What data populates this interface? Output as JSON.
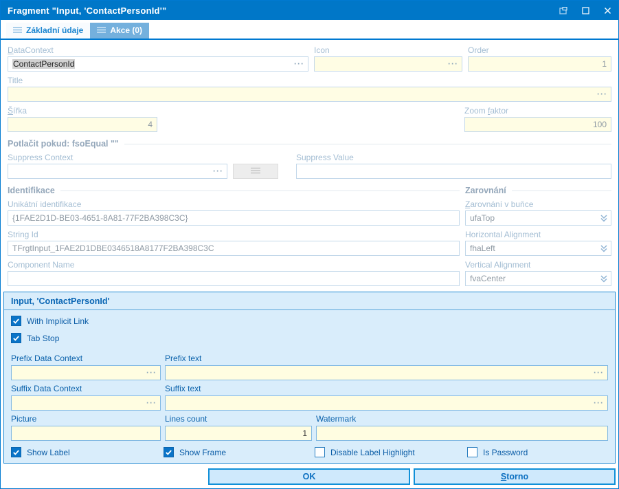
{
  "window": {
    "title": "Fragment \"Input, 'ContactPersonId'\""
  },
  "tabs": [
    {
      "label": "Základní údaje",
      "active": true
    },
    {
      "label": "Akce (0)",
      "active": false
    }
  ],
  "form": {
    "datacontext_label": "DataContext",
    "datacontext_value": "ContactPersonId",
    "icon_label": "Icon",
    "icon_value": "",
    "order_label": "Order",
    "order_value": "1",
    "title_label": "Title",
    "title_value": "",
    "sirka_label": "Šířka",
    "sirka_value": "4",
    "zoom_label": "Zoom faktor",
    "zoom_value": "100",
    "suppress_section": "Potlačit pokud:  fsoEqual \"\"",
    "suppress_context_label": "Suppress Context",
    "suppress_context_value": "",
    "suppress_value_label": "Suppress Value",
    "suppress_value_value": "",
    "identifikace_section": "Identifikace",
    "zarovnani_section": "Zarovnání",
    "unikatni_label": "Unikátní identifikace",
    "unikatni_value": "{1FAE2D1D-BE03-4651-8A81-77F2BA398C3C}",
    "string_id_label": "String Id",
    "string_id_value": "TFrgtInput_1FAE2D1DBE0346518A8177F2BA398C3C",
    "component_name_label": "Component Name",
    "component_name_value": "",
    "cell_align_label": "Zarovnání v buňce",
    "cell_align_value": "ufaTop",
    "horizontal_align_label": "Horizontal Alignment",
    "horizontal_align_value": "fhaLeft",
    "vertical_align_label": "Vertical Alignment",
    "vertical_align_value": "fvaCenter"
  },
  "input_group": {
    "header": "Input, 'ContactPersonId'",
    "with_implicit_link": "With Implicit Link",
    "with_implicit_link_checked": true,
    "tab_stop": "Tab Stop",
    "tab_stop_checked": true,
    "prefix_data_context_label": "Prefix Data Context",
    "prefix_data_context_value": "",
    "prefix_text_label": "Prefix text",
    "prefix_text_value": "",
    "suffix_data_context_label": "Suffix Data Context",
    "suffix_data_context_value": "",
    "suffix_text_label": "Suffix text",
    "suffix_text_value": "",
    "picture_label": "Picture",
    "picture_value": "",
    "lines_count_label": "Lines count",
    "lines_count_value": "1",
    "watermark_label": "Watermark",
    "watermark_value": "",
    "show_label": "Show Label",
    "show_label_checked": true,
    "show_frame": "Show Frame",
    "show_frame_checked": true,
    "disable_label_highlight": "Disable Label Highlight",
    "disable_label_highlight_checked": false,
    "is_password": "Is Password",
    "is_password_checked": false
  },
  "buttons": {
    "ok": "OK",
    "storno": "Storno"
  },
  "misc": {
    "ellipsis": "···"
  },
  "icons": [
    "hamburger-icon",
    "dock-icon",
    "maximize-icon",
    "close-icon",
    "chevron-down-icon",
    "check-icon",
    "ellipsis-icon"
  ],
  "colors": {
    "titlebar": "#0077c8",
    "accent": "#0079d1",
    "panel_bg": "#d9edfb",
    "field_yellow": "#fffde4",
    "checkbox_blue": "#0a74c8"
  }
}
